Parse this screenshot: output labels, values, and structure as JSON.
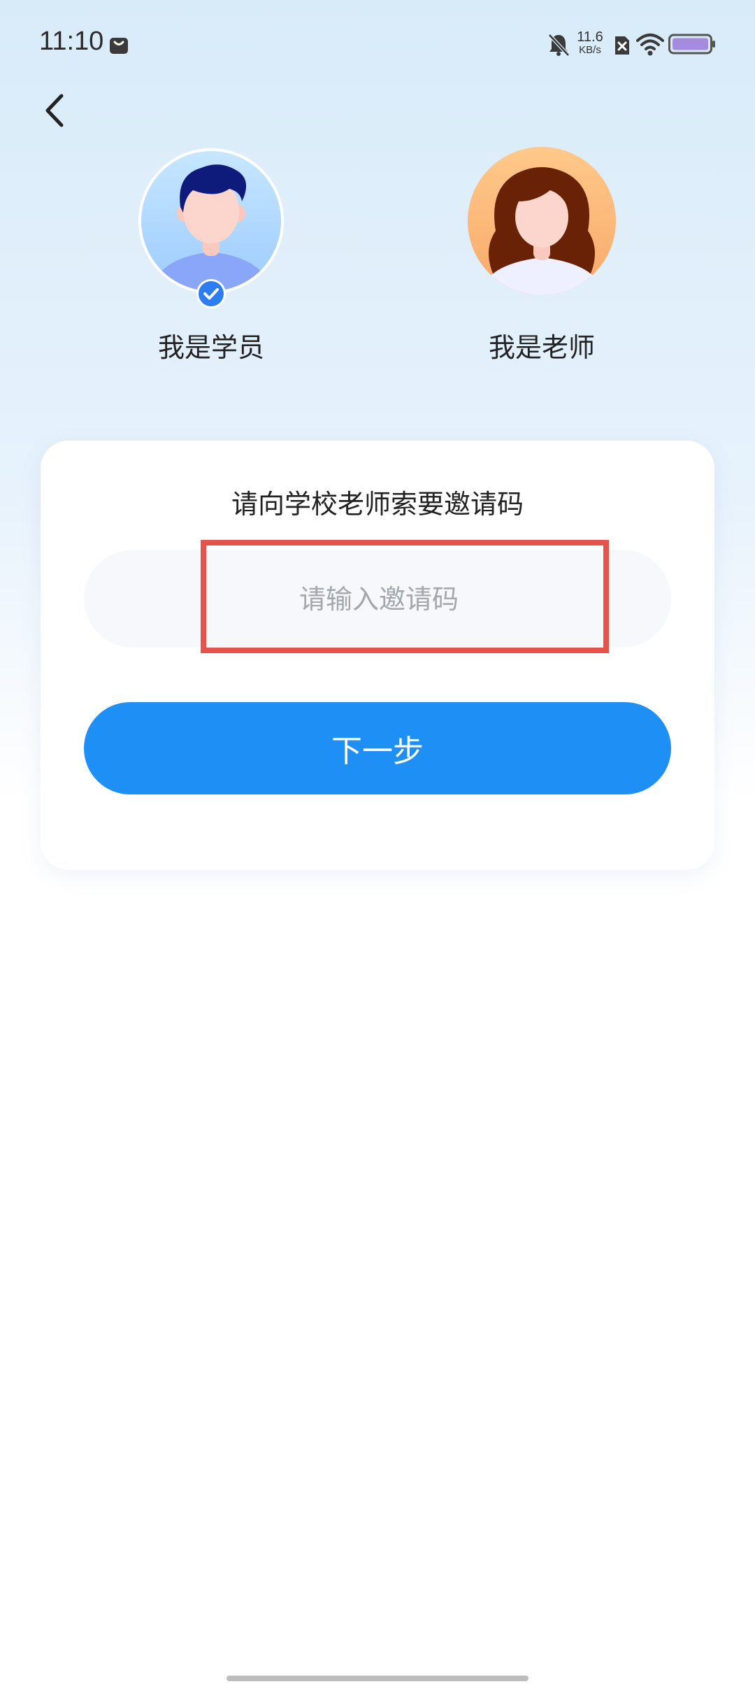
{
  "status_bar": {
    "time": "11:10",
    "net_speed_value": "11.6",
    "net_speed_unit": "KB/s",
    "icons": [
      "shopping-bag-icon",
      "bell-muted-icon",
      "sim-error-icon",
      "wifi-icon",
      "battery-icon"
    ]
  },
  "nav": {
    "back_icon": "chevron-left-icon"
  },
  "roles": {
    "student": {
      "label": "我是学员",
      "selected": true
    },
    "teacher": {
      "label": "我是老师",
      "selected": false
    }
  },
  "card": {
    "title": "请向学校老师索要邀请码",
    "input_placeholder": "请输入邀请码",
    "input_value": "",
    "next_label": "下一步"
  },
  "colors": {
    "accent": "#1e90f5",
    "highlight": "#e5534b",
    "text": "#222222",
    "placeholder": "#a3a7ae"
  }
}
